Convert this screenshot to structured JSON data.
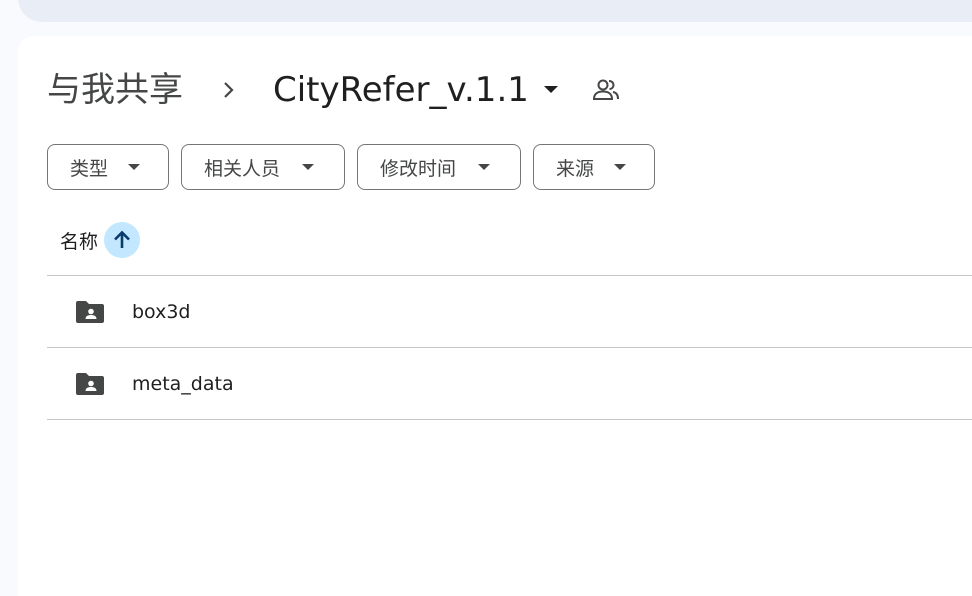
{
  "breadcrumb": {
    "root": "与我共享",
    "current": "CityRefer_v.1.1"
  },
  "filters": [
    {
      "label": "类型"
    },
    {
      "label": "相关人员"
    },
    {
      "label": "修改时间"
    },
    {
      "label": "来源"
    }
  ],
  "table": {
    "column_name": "名称",
    "sort_direction": "ascending",
    "rows": [
      {
        "name": "box3d",
        "icon": "shared-folder-icon"
      },
      {
        "name": "meta_data",
        "icon": "shared-folder-icon"
      }
    ]
  },
  "colors": {
    "accent": "#c2e7ff",
    "sort_arrow": "#0b57d0",
    "background": "#f8fafd",
    "panel": "#ffffff"
  }
}
